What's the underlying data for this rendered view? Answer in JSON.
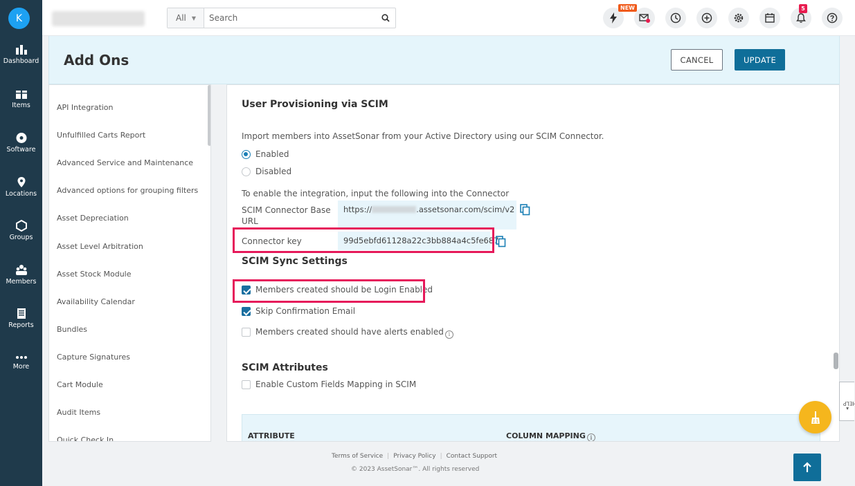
{
  "user": {
    "initial": "K"
  },
  "nav": [
    {
      "key": "dashboard",
      "label": "Dashboard"
    },
    {
      "key": "items",
      "label": "Items"
    },
    {
      "key": "software",
      "label": "Software"
    },
    {
      "key": "locations",
      "label": "Locations"
    },
    {
      "key": "groups",
      "label": "Groups"
    },
    {
      "key": "members",
      "label": "Members"
    },
    {
      "key": "reports",
      "label": "Reports"
    },
    {
      "key": "more",
      "label": "More"
    }
  ],
  "search": {
    "scope": "All",
    "placeholder": "Search"
  },
  "topbar": {
    "new_badge": "NEW",
    "notification_count": "5"
  },
  "page": {
    "title": "Add Ons",
    "cancel_label": "CANCEL",
    "update_label": "UPDATE"
  },
  "addons_list": [
    "API Integration",
    "Unfulfilled Carts Report",
    "Advanced Service and Maintenance",
    "Advanced options for grouping filters",
    "Asset Depreciation",
    "Asset Level Arbitration",
    "Asset Stock Module",
    "Availability Calendar",
    "Bundles",
    "Capture Signatures",
    "Cart Module",
    "Audit Items",
    "Quick Check In"
  ],
  "scim": {
    "title": "User Provisioning via SCIM",
    "description": "Import members into AssetSonar from your Active Directory using our SCIM Connector.",
    "enabled_label": "Enabled",
    "disabled_label": "Disabled",
    "enabled": true,
    "connector_hint": "To enable the integration, input the following into the Connector",
    "base_url_label_line1": "SCIM Connector Base",
    "base_url_label_line2": "URL",
    "base_url_prefix": "https://",
    "base_url_suffix": ".assetsonar.com/scim/v2",
    "connector_key_label": "Connector key",
    "connector_key_value": "99d5ebfd61128a22c3bb884a4c5fe687"
  },
  "sync_settings": {
    "title": "SCIM Sync Settings",
    "options": [
      {
        "label": "Members created should be Login Enabled",
        "checked": true
      },
      {
        "label": "Skip Confirmation Email",
        "checked": true
      },
      {
        "label": "Members created should have alerts enabled",
        "checked": false
      }
    ]
  },
  "attributes": {
    "title": "SCIM Attributes",
    "custom_mapping_label": "Enable Custom Fields Mapping in SCIM",
    "col_attribute": "ATTRIBUTE",
    "col_mapping": "COLUMN MAPPING"
  },
  "help_label": "HELP",
  "footer": {
    "terms": "Terms of Service",
    "privacy": "Privacy Policy",
    "contact": "Contact Support",
    "copyright": "© 2023 AssetSonar™. All rights reserved"
  },
  "colors": {
    "nav_bg": "#1f3a4b",
    "primary": "#0f6e99",
    "highlight": "#e6195a",
    "fab": "#f5b61d"
  }
}
